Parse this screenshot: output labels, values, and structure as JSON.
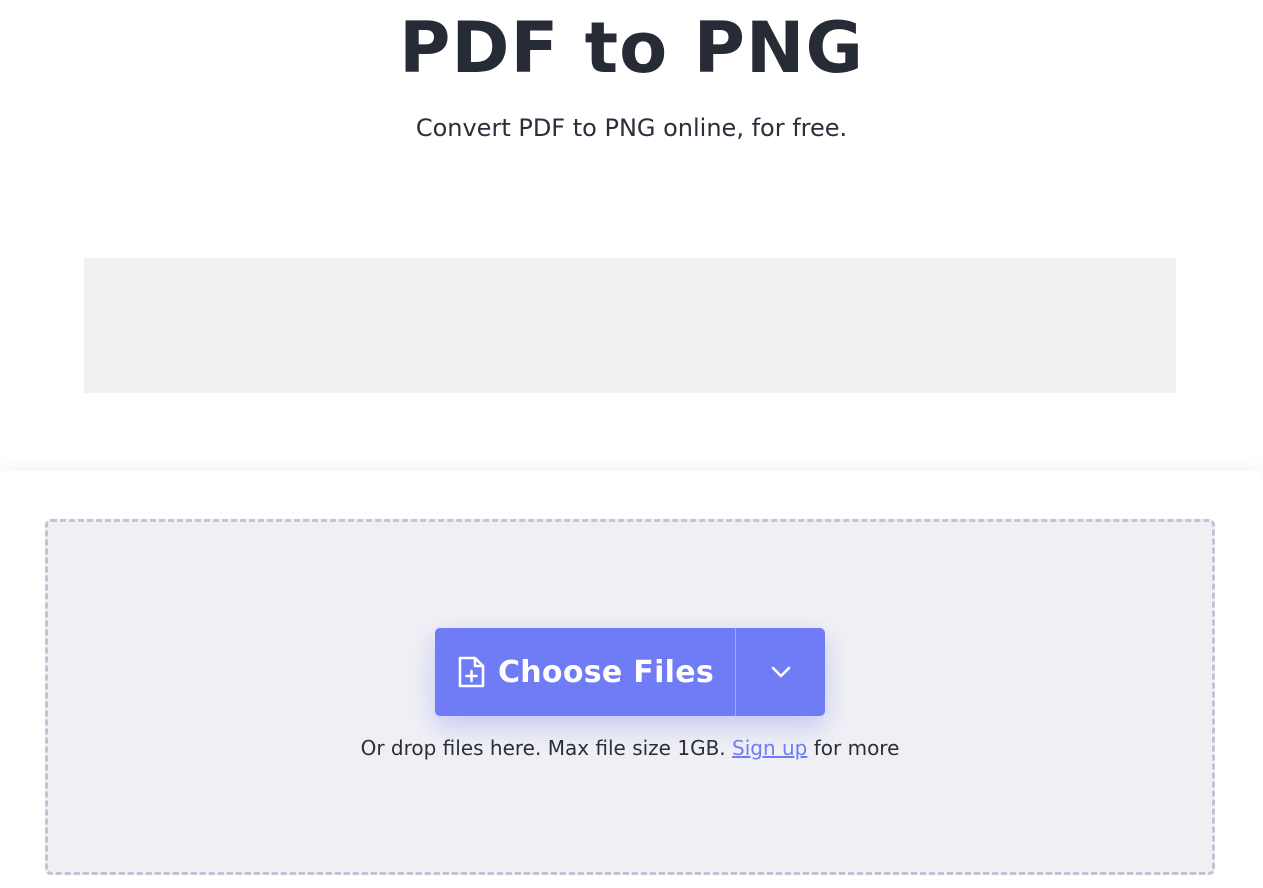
{
  "header": {
    "title": "PDF to PNG",
    "subtitle": "Convert PDF to PNG online, for free."
  },
  "upload": {
    "choose_label": "Choose Files",
    "hint_prefix": "Or drop files here. Max file size 1GB.",
    "signup_link": "Sign up",
    "hint_suffix": "for more"
  },
  "icons": {
    "choose": "file-plus-icon",
    "dropdown": "chevron-down-icon"
  },
  "colors": {
    "accent": "#6f7cf6",
    "dropzone_bg": "#f0f0f4",
    "dropzone_border": "#c4c3d6",
    "ad_bg": "#f1f1f2",
    "title_text": "#262b35"
  }
}
